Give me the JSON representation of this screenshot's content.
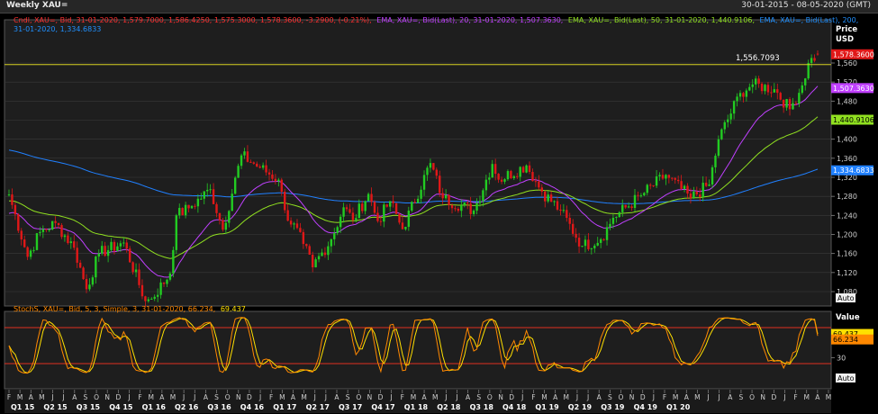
{
  "title": "Weekly XAU=",
  "date_range": "30-01-2015 - 08-05-2020 (GMT)",
  "colors": {
    "background": "#000000",
    "price_panel": "#1e1e1e",
    "grid": "#3a3a3a",
    "candle_up": "#22cc22",
    "candle_down": "#e01818",
    "ema20": "#c040ff",
    "ema50": "#90e020",
    "ema200": "#2080ff",
    "hline": "#d6d020",
    "stoch_k": "#ff8800",
    "stoch_d": "#ffe000",
    "stoch_band": "#e03020"
  },
  "legend": {
    "candle_label": "Cndl, XAU=, Bid, 31-01-2020, 1,579.7000, 1,586.4250, 1,575.3000, 1,578.3600, -3.2900, (-0.21%),",
    "ema20_label": "EMA, XAU=, Bid(Last), 20, 31-01-2020, 1,507.3630,",
    "ema50_label": "EMA, XAU=, Bid(Last), 50, 31-01-2020, 1,440.9106,",
    "ema200_label_1": "EMA, XAU=, Bid(Last), 200,",
    "ema200_label_2": "31-01-2020, 1,334.6833",
    "stoch_label_main": "StochS, XAU=, Bid, 5, 3, Simple, 3, 31-01-2020, 66.234,",
    "stoch_label_d": "69.437"
  },
  "price_axis": {
    "header_1": "Price",
    "header_2": "USD",
    "auto_label": "Auto",
    "ticks": [
      "1,560",
      "1,520",
      "1,480",
      "1,440",
      "1,400",
      "1,360",
      "1,320",
      "1,280",
      "1,240",
      "1,200",
      "1,160",
      "1,120",
      "1,080"
    ],
    "tick_values": [
      1560,
      1520,
      1480,
      1440,
      1400,
      1360,
      1320,
      1280,
      1240,
      1200,
      1160,
      1120,
      1080
    ]
  },
  "stoch_axis": {
    "header": "Value",
    "auto_label": "Auto",
    "ticks": [
      "30"
    ],
    "tick_values": [
      30
    ],
    "upper_band": 80,
    "lower_band": 20
  },
  "badges": {
    "last_price": "1,578.3600",
    "ema20": "1,507.3630",
    "ema50": "1,440.9106",
    "ema200": "1,334.6833",
    "stoch_d": "69.437",
    "stoch_k": "66.234"
  },
  "hline_label": "1,556.7093",
  "x_axis": {
    "months": [
      "F",
      "M",
      "A",
      "M",
      "J",
      "J",
      "A",
      "S",
      "O",
      "N",
      "D",
      "J",
      "F",
      "M",
      "A",
      "M",
      "J",
      "J",
      "A",
      "S",
      "O",
      "N",
      "D",
      "J",
      "F",
      "M",
      "A",
      "M",
      "J",
      "J",
      "A",
      "S",
      "O",
      "N",
      "D",
      "J",
      "F",
      "M",
      "A",
      "M",
      "J",
      "J",
      "A",
      "S",
      "O",
      "N",
      "D",
      "J",
      "F",
      "M",
      "A",
      "M",
      "J",
      "J",
      "A",
      "S",
      "O",
      "N",
      "D",
      "J",
      "F",
      "M",
      "A",
      "M",
      "J",
      "J",
      "A",
      "S",
      "O",
      "N",
      "D",
      "J",
      "F",
      "M",
      "A",
      "M"
    ],
    "quarters": [
      "Q1 15",
      "Q2 15",
      "Q3 15",
      "Q4 15",
      "Q1 16",
      "Q2 16",
      "Q3 16",
      "Q4 16",
      "Q1 17",
      "Q2 17",
      "Q3 17",
      "Q4 17",
      "Q1 18",
      "Q2 18",
      "Q3 18",
      "Q4 18",
      "Q1 19",
      "Q2 19",
      "Q3 19",
      "Q4 19",
      "Q1 20"
    ]
  },
  "chart_data": [
    {
      "type": "candlestick",
      "title": "Weekly XAU=",
      "ylabel": "Price USD",
      "ylim": [
        1050,
        1600
      ],
      "x_start": "2015-01-30",
      "x_end_visible": "2020-01-31",
      "x_axis_end": "2020-05-08",
      "anchor_closes": [
        [
          "2015-01-30",
          1284
        ],
        [
          "2015-03-13",
          1153
        ],
        [
          "2015-04-10",
          1205
        ],
        [
          "2015-05-15",
          1224
        ],
        [
          "2015-06-26",
          1172
        ],
        [
          "2015-07-24",
          1085
        ],
        [
          "2015-08-21",
          1160
        ],
        [
          "2015-10-16",
          1183
        ],
        [
          "2015-12-04",
          1060
        ],
        [
          "2015-12-18",
          1065
        ],
        [
          "2016-01-29",
          1118
        ],
        [
          "2016-02-12",
          1240
        ],
        [
          "2016-03-11",
          1255
        ],
        [
          "2016-04-29",
          1295
        ],
        [
          "2016-05-27",
          1210
        ],
        [
          "2016-07-08",
          1366
        ],
        [
          "2016-08-19",
          1340
        ],
        [
          "2016-09-30",
          1315
        ],
        [
          "2016-10-14",
          1251
        ],
        [
          "2016-11-25",
          1180
        ],
        [
          "2016-12-16",
          1131
        ],
        [
          "2017-01-27",
          1190
        ],
        [
          "2017-02-24",
          1257
        ],
        [
          "2017-03-17",
          1230
        ],
        [
          "2017-04-21",
          1285
        ],
        [
          "2017-05-12",
          1228
        ],
        [
          "2017-06-09",
          1270
        ],
        [
          "2017-07-07",
          1211
        ],
        [
          "2017-09-08",
          1350
        ],
        [
          "2017-10-06",
          1276
        ],
        [
          "2017-12-15",
          1250
        ],
        [
          "2018-01-26",
          1348
        ],
        [
          "2018-02-09",
          1315
        ],
        [
          "2018-04-13",
          1345
        ],
        [
          "2018-05-18",
          1290
        ],
        [
          "2018-06-29",
          1250
        ],
        [
          "2018-08-17",
          1176
        ],
        [
          "2018-09-28",
          1190
        ],
        [
          "2018-10-26",
          1235
        ],
        [
          "2018-12-28",
          1282
        ],
        [
          "2019-02-22",
          1325
        ],
        [
          "2019-04-19",
          1276
        ],
        [
          "2019-05-31",
          1305
        ],
        [
          "2019-06-21",
          1400
        ],
        [
          "2019-08-09",
          1497
        ],
        [
          "2019-09-06",
          1515
        ],
        [
          "2019-10-25",
          1505
        ],
        [
          "2019-11-29",
          1463
        ],
        [
          "2019-12-27",
          1513
        ],
        [
          "2020-01-10",
          1560
        ],
        [
          "2020-01-31",
          1578.36
        ]
      ],
      "last_candle": {
        "date": "2020-01-31",
        "open": 1579.7,
        "high": 1586.425,
        "low": 1575.3,
        "close": 1578.36,
        "change": -3.29,
        "change_pct": -0.21
      },
      "series": [
        {
          "name": "EMA 20",
          "last_value": 1507.363
        },
        {
          "name": "EMA 50",
          "last_value": 1440.9106
        },
        {
          "name": "EMA 200",
          "last_value": 1334.6833
        }
      ],
      "reference_line": 1556.7093
    },
    {
      "type": "line",
      "title": "StochS, XAU=, Bid, 5, 3, Simple, 3",
      "ylabel": "Value",
      "ylim": [
        0,
        100
      ],
      "bands": [
        20,
        80
      ],
      "series": [
        {
          "name": "%K",
          "last_value": 66.234
        },
        {
          "name": "%D",
          "last_value": 69.437
        }
      ]
    }
  ]
}
